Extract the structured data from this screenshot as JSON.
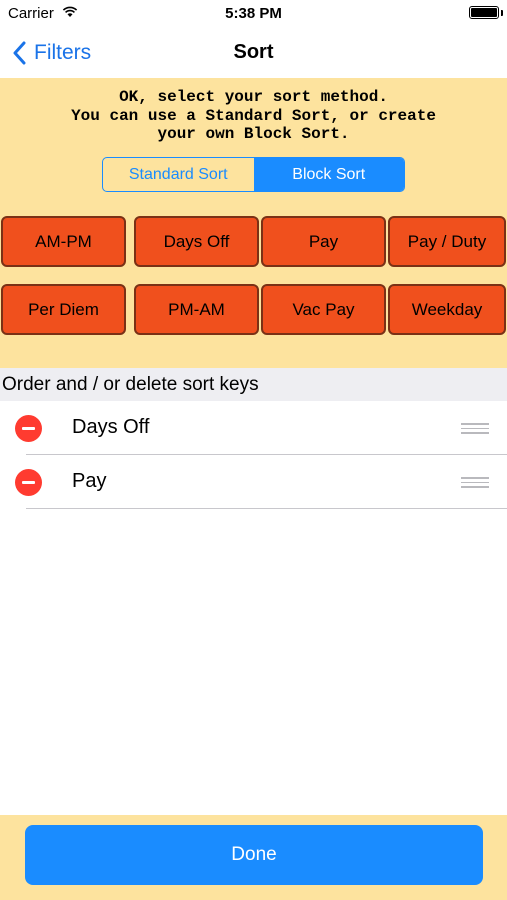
{
  "status": {
    "carrier": "Carrier",
    "time": "5:38 PM"
  },
  "nav": {
    "back_label": "Filters",
    "title": "Sort"
  },
  "panel": {
    "instructions": "OK, select your sort method.\nYou can use a Standard Sort, or create\nyour own Block Sort.",
    "segments": {
      "left": "Standard Sort",
      "right": "Block Sort",
      "selected": "Block Sort"
    },
    "sort_buttons": [
      "AM-PM",
      "Days Off",
      "Pay",
      "Pay / Duty",
      "Per Diem",
      "PM-AM",
      "Vac Pay",
      "Weekday"
    ]
  },
  "section": {
    "header": "Order and / or delete sort keys"
  },
  "sort_keys": [
    {
      "label": "Days Off"
    },
    {
      "label": "Pay"
    }
  ],
  "footer": {
    "done_label": "Done"
  },
  "colors": {
    "accent": "#1a8cff",
    "panel": "#fde39e",
    "sort_button": "#f0501d",
    "delete": "#ff3b30"
  }
}
